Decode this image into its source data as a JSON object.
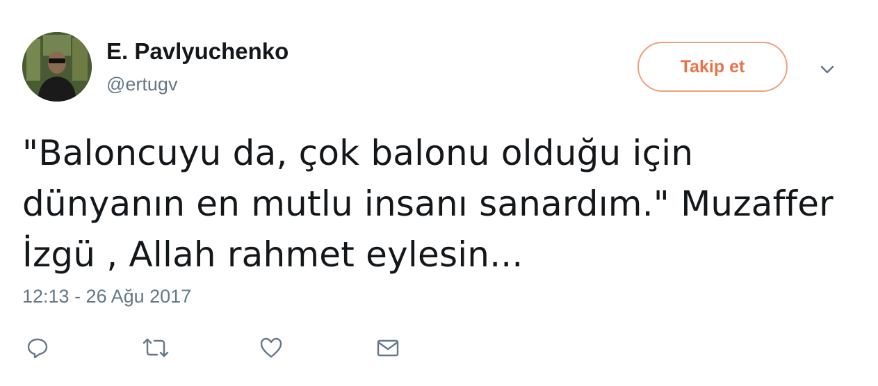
{
  "user": {
    "display_name": "E. Pavlyuchenko",
    "screen_name": "@ertugv",
    "avatar_icon": "profile-photo"
  },
  "follow_button": {
    "label": "Takip et",
    "accent_color": "#e8734a"
  },
  "menu": {
    "icon": "chevron-down-icon"
  },
  "tweet": {
    "text": "\"Baloncuyu da, çok balonu olduğu için\ndünyanın en mutlu insanı sanardım.\" Muzaffer\nİzgü , Allah rahmet eylesin...",
    "timestamp": "12:13 - 26 Ağu 2017"
  },
  "actions": [
    {
      "name": "reply",
      "icon": "reply-icon"
    },
    {
      "name": "retweet",
      "icon": "retweet-icon"
    },
    {
      "name": "like",
      "icon": "heart-icon"
    },
    {
      "name": "direct-message",
      "icon": "envelope-icon"
    }
  ],
  "colors": {
    "text": "#14171a",
    "secondary_text": "#657786",
    "icon": "#657786"
  }
}
